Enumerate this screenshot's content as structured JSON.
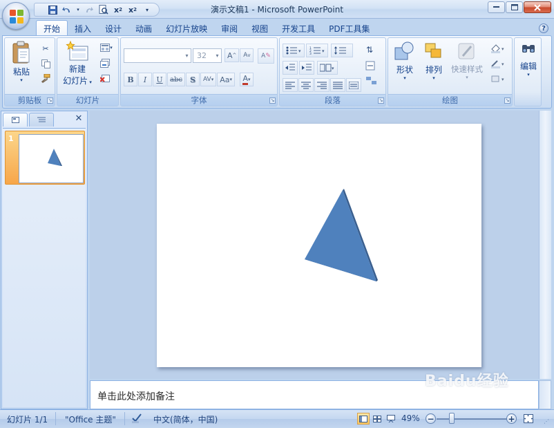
{
  "window": {
    "title": "演示文稿1 - Microsoft PowerPoint"
  },
  "tabs": [
    "开始",
    "插入",
    "设计",
    "动画",
    "幻灯片放映",
    "审阅",
    "视图",
    "开发工具",
    "PDF工具集"
  ],
  "active_tab": "开始",
  "ribbon": {
    "clipboard": {
      "label": "剪贴板",
      "paste": "粘贴"
    },
    "slides": {
      "label": "幻灯片",
      "new_slide_line1": "新建",
      "new_slide_line2": "幻灯片"
    },
    "font": {
      "label": "字体",
      "font_name": "",
      "font_size": "32"
    },
    "paragraph": {
      "label": "段落"
    },
    "drawing": {
      "label": "绘图",
      "shapes": "形状",
      "arrange": "排列",
      "quick_styles": "快速样式"
    },
    "editing": {
      "label": "编辑"
    }
  },
  "thumbnails": {
    "slide_number": "1"
  },
  "notes": {
    "placeholder": "单击此处添加备注"
  },
  "status": {
    "slide_info": "幻灯片 1/1",
    "theme": "\"Office 主题\"",
    "language": "中文(简体，中国)",
    "zoom": "49%"
  },
  "watermark": {
    "text": "Baidu经验",
    "sub": "jingyan.baidu.com"
  },
  "colors": {
    "shape_fill": "#4f81bd",
    "shape_side": "#3a5f8f",
    "ribbon_text": "#15428b",
    "thumb_selected": "#f7a649"
  }
}
